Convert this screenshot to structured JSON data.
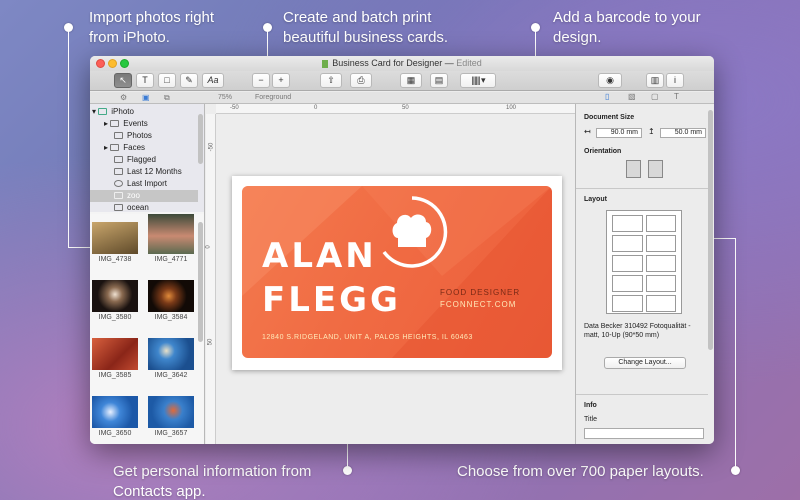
{
  "captions": {
    "import": "Import photos right\nfrom iPhoto.",
    "create": "Create and batch print\nbeautiful business cards.",
    "barcode": "Add a barcode to your\ndesign.",
    "contacts": "Get personal information from\nContacts app.",
    "layouts": "Choose from over 700 paper layouts."
  },
  "window": {
    "title": "Business Card for Designer",
    "status": "Edited",
    "zoom": "75%",
    "layer": "Foreground",
    "font_button": "Aa"
  },
  "source_list": {
    "items": [
      {
        "label": "iPhoto",
        "icon": "iphoto-icon"
      },
      {
        "label": "Events",
        "icon": "events-icon"
      },
      {
        "label": "Photos",
        "icon": "photos-icon"
      },
      {
        "label": "Faces",
        "icon": "faces-icon"
      },
      {
        "label": "Flagged",
        "icon": "flag-icon"
      },
      {
        "label": "Last 12 Months",
        "icon": "calendar-icon"
      },
      {
        "label": "Last Import",
        "icon": "clock-icon"
      },
      {
        "label": "zoo",
        "icon": "album-icon"
      },
      {
        "label": "ocean",
        "icon": "album-icon"
      }
    ]
  },
  "photos": [
    {
      "label": "IMG_4738",
      "color": "#8c6d3a"
    },
    {
      "label": "IMG_4771",
      "color": "#a36b55"
    },
    {
      "label": "IMG_3580",
      "color": "#2a1e18"
    },
    {
      "label": "IMG_3584",
      "color": "#3a2416"
    },
    {
      "label": "IMG_3585",
      "color": "#b83e2c"
    },
    {
      "label": "IMG_3642",
      "color": "#2f6fb3"
    },
    {
      "label": "IMG_3650",
      "color": "#2d6fc0"
    },
    {
      "label": "IMG_3657",
      "color": "#2c72c6"
    }
  ],
  "card": {
    "first_name": "ALAN",
    "last_name": "FLEGG",
    "title": "FOOD DESIGNER",
    "website": "FCONNECT.COM",
    "address": "12840 S.RIDGELAND, UNIT A, PALOS HEIGHTS, IL 60463",
    "color": "#f06b43"
  },
  "rulers": {
    "h": [
      "-50",
      "0",
      "50",
      "100"
    ],
    "v": [
      "-50",
      "0",
      "50"
    ]
  },
  "inspector": {
    "document_size_label": "Document Size",
    "width": "90.0 mm",
    "height": "50.0 mm",
    "orientation_label": "Orientation",
    "layout_label": "Layout",
    "layout_desc": "Data Becker 310492 Fotoqualität - matt, 10-Up (90*50 mm)",
    "change_layout": "Change Layout...",
    "info_label": "Info",
    "title_label": "Title"
  }
}
